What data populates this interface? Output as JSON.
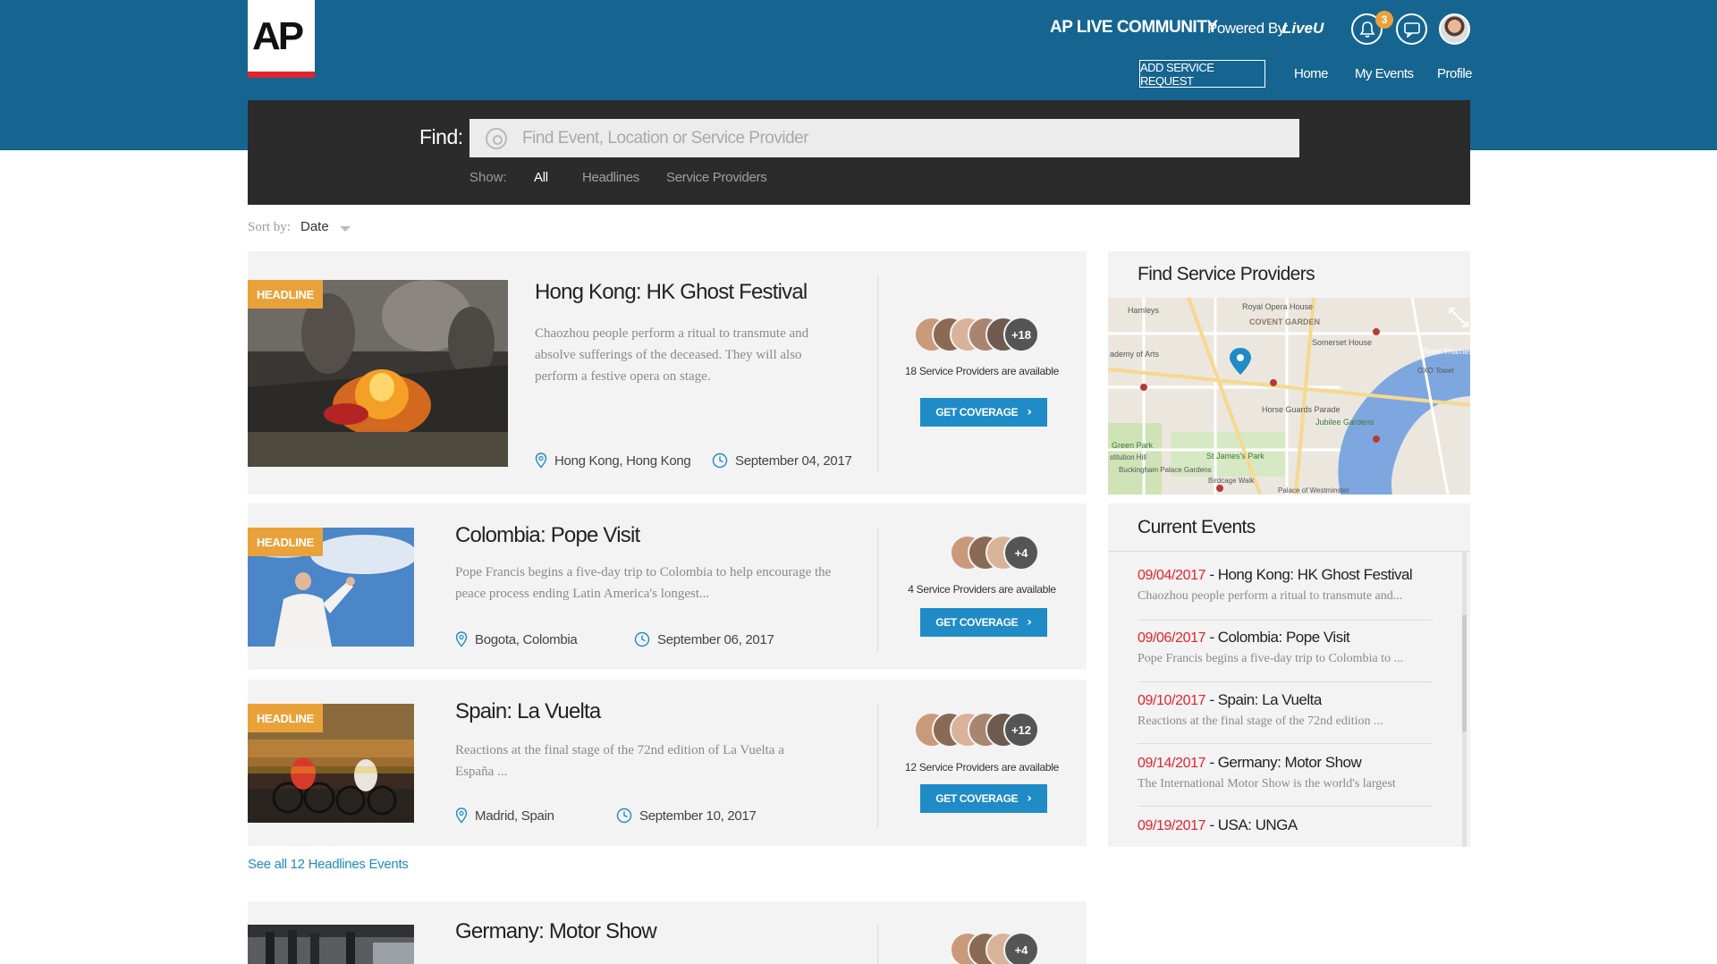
{
  "header": {
    "logo_text": "AP",
    "community": "AP LIVE COMMUNITY",
    "powered_by": "Powered By:",
    "powered_brand": "LiveU",
    "notification_count": "3",
    "add_service_request": "ADD SERVICE REQUEST",
    "nav": [
      {
        "label": "Home"
      },
      {
        "label": "My Events"
      },
      {
        "label": "Profile"
      }
    ]
  },
  "search": {
    "find_label": "Find:",
    "placeholder": "Find Event, Location or Service Provider",
    "show_label": "Show:",
    "tabs": [
      {
        "label": "All",
        "active": true
      },
      {
        "label": "Headlines",
        "active": false
      },
      {
        "label": "Service Providers",
        "active": false
      }
    ]
  },
  "sort": {
    "label": "Sort by:",
    "value": "Date"
  },
  "events": [
    {
      "badge": "HEADLINE",
      "title": "Hong Kong: HK Ghost Festival",
      "description": "Chaozhou people perform a ritual to transmute and absolve sufferings of the deceased. They will also perform a festive opera on stage.",
      "location": "Hong Kong, Hong Kong",
      "date": "September 04, 2017",
      "more_count": "+18",
      "providers_text": "18 Service Providers are available",
      "cta": "GET COVERAGE"
    },
    {
      "badge": "HEADLINE",
      "title": "Colombia: Pope Visit",
      "description": "Pope Francis begins a five-day trip to Colombia to help encourage the peace process ending Latin America's longest...",
      "location": "Bogota, Colombia",
      "date": "September 06, 2017",
      "more_count": "+4",
      "providers_text": "4 Service Providers are available",
      "cta": "GET COVERAGE"
    },
    {
      "badge": "HEADLINE",
      "title": "Spain: La Vuelta",
      "description": "Reactions at the final stage of the 72nd edition of La Vuelta a España ...",
      "location": "Madrid, Spain",
      "date": "September 10, 2017",
      "more_count": "+12",
      "providers_text": "12 Service Providers are available",
      "cta": "GET COVERAGE"
    },
    {
      "title": "Germany: Motor Show",
      "more_count": "+4"
    }
  ],
  "see_all": "See all 12 Headlines Events",
  "sidebar": {
    "providers_title": "Find Service Providers",
    "map_labels": {
      "hamleys": "Hamleys",
      "royal_opera": "Royal Opera House",
      "covent_garden": "COVENT GARDEN",
      "arts": "ademy of Arts",
      "somerset": "Somerset House",
      "river": "River Thames",
      "oxo": "OXO Tower",
      "horse_guards": "Horse Guards Parade",
      "jubilee": "Jubilee Gardens",
      "green_park": "Green Park",
      "james_park": "St James's Park",
      "stitution_hill": "stitution Hill",
      "buckingham": "Buckingham Palace Gardens",
      "birdcage": "Birdcage Walk",
      "westminster": "Palace of Westminster"
    },
    "events_title": "Current Events",
    "current_events": [
      {
        "date": "09/04/2017",
        "title": " - Hong Kong: HK Ghost Festival",
        "desc": "Chaozhou people perform a ritual to transmute and..."
      },
      {
        "date": "09/06/2017",
        "title": " - Colombia: Pope Visit",
        "desc": "Pope Francis begins a five-day trip to Colombia to ..."
      },
      {
        "date": "09/10/2017",
        "title": " - Spain: La Vuelta",
        "desc": "Reactions at the final stage of the 72nd edition ..."
      },
      {
        "date": "09/14/2017",
        "title": " - Germany: Motor Show",
        "desc": "The International Motor Show is the world's largest"
      },
      {
        "date": "09/19/2017",
        "title": " - USA: UNGA",
        "desc": ""
      }
    ]
  },
  "colors": {
    "brand_blue": "#166591",
    "accent_orange": "#e9a23a",
    "cta_blue": "#1f8bc7",
    "date_red": "#e2242c"
  }
}
